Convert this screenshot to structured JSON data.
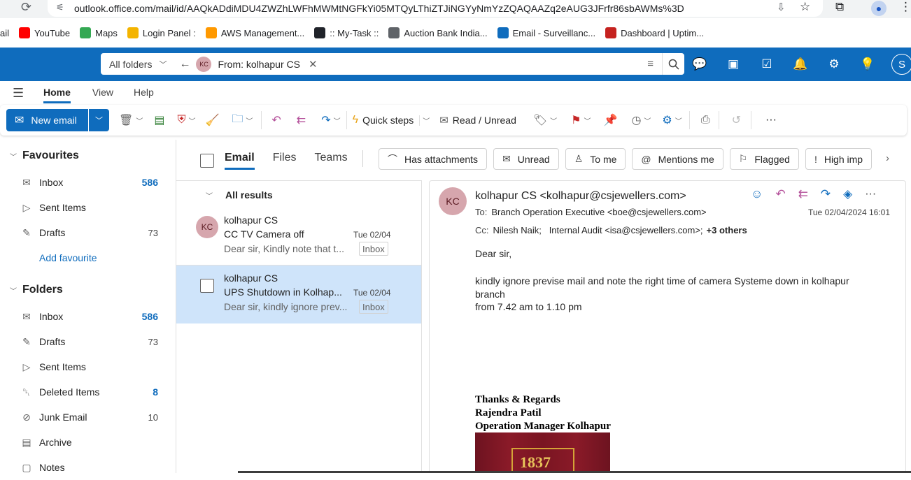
{
  "browser": {
    "url": "outlook.office.com/mail/id/AAQkADdiMDU4ZWZhLWFhMWMtNGFkYi05MTQyLThiZTJiNGYyNmYzZQAQAAZq2eAUG3JFrfr86sbAWMs%3D",
    "bookmarks": [
      {
        "label": "ail",
        "icon": "gmail-icon",
        "color": "#ea4335"
      },
      {
        "label": "YouTube",
        "icon": "youtube-icon",
        "color": "#ff0000"
      },
      {
        "label": "Maps",
        "icon": "maps-icon",
        "color": "#34a853"
      },
      {
        "label": "Login Panel :",
        "icon": "login-icon",
        "color": "#f4b400"
      },
      {
        "label": "AWS Management...",
        "icon": "aws-icon",
        "color": "#ff9900"
      },
      {
        "label": ":: My-Task ::",
        "icon": "react-icon",
        "color": "#20232a"
      },
      {
        "label": "Auction Bank India...",
        "icon": "bank-icon",
        "color": "#5f6368"
      },
      {
        "label": "Email - Surveillanc...",
        "icon": "outlook-icon",
        "color": "#0f6cbd"
      },
      {
        "label": "Dashboard | Uptim...",
        "icon": "uptime-icon",
        "color": "#c5221f"
      }
    ]
  },
  "header": {
    "scope": "All folders",
    "chip_initials": "KC",
    "chip_label": "From: kolhapur CS",
    "profile_initial": "S"
  },
  "ribbon": {
    "tabs": [
      "Home",
      "View",
      "Help"
    ],
    "new_email": "New email",
    "quick_steps": "Quick steps",
    "read_unread": "Read / Unread",
    "more": "···"
  },
  "folders": {
    "favourites_title": "Favourites",
    "favourites": [
      {
        "icon": "inbox-icon",
        "glyph": "✉",
        "label": "Inbox",
        "count": "586",
        "bold": true
      },
      {
        "icon": "send-icon",
        "glyph": "▷",
        "label": "Sent Items",
        "count": "",
        "bold": false
      },
      {
        "icon": "pencil-icon",
        "glyph": "✎",
        "label": "Drafts",
        "count": "73",
        "bold": false
      }
    ],
    "add_favourite": "Add favourite",
    "folders_title": "Folders",
    "items": [
      {
        "icon": "inbox-icon",
        "glyph": "✉",
        "label": "Inbox",
        "count": "586",
        "bold": true
      },
      {
        "icon": "pencil-icon",
        "glyph": "✎",
        "label": "Drafts",
        "count": "73",
        "bold": false
      },
      {
        "icon": "send-icon",
        "glyph": "▷",
        "label": "Sent Items",
        "count": "",
        "bold": false
      },
      {
        "icon": "trash-icon",
        "glyph": "␡",
        "label": "Deleted Items",
        "count": "8",
        "bold": true
      },
      {
        "icon": "junk-icon",
        "glyph": "⊘",
        "label": "Junk Email",
        "count": "10",
        "bold": false
      },
      {
        "icon": "archive-icon",
        "glyph": "▤",
        "label": "Archive",
        "count": "",
        "bold": false
      },
      {
        "icon": "notes-icon",
        "glyph": "▢",
        "label": "Notes",
        "count": "",
        "bold": false
      }
    ]
  },
  "filters": {
    "tabs": [
      "Email",
      "Files",
      "Teams"
    ],
    "pills": [
      {
        "icon": "paperclip-icon",
        "glyph": "⌒",
        "label": "Has attachments"
      },
      {
        "icon": "unread-icon",
        "glyph": "✉",
        "label": "Unread"
      },
      {
        "icon": "person-icon",
        "glyph": "♙",
        "label": "To me"
      },
      {
        "icon": "mention-icon",
        "glyph": "@",
        "label": "Mentions me"
      },
      {
        "icon": "flag-icon",
        "glyph": "⚐",
        "label": "Flagged"
      },
      {
        "icon": "importance-icon",
        "glyph": "!",
        "label": "High imp"
      }
    ]
  },
  "list": {
    "group": "All results",
    "messages": [
      {
        "initials": "KC",
        "sender": "kolhapur CS",
        "subject": "CC TV Camera off",
        "date": "Tue 02/04",
        "preview": "Dear sir, Kindly note that t...",
        "folder": "Inbox",
        "selected": false
      },
      {
        "initials": "",
        "sender": "kolhapur CS",
        "subject": "UPS Shutdown in Kolhap...",
        "date": "Tue 02/04",
        "preview": "Dear sir, kindly ignore prev...",
        "folder": "Inbox",
        "selected": true
      }
    ]
  },
  "reading": {
    "initials": "KC",
    "from": "kolhapur CS <kolhapur@csjewellers.com>",
    "to_label": "To:",
    "to": "Branch Operation Executive <boe@csjewellers.com>",
    "datetime": "Tue 02/04/2024 16:01",
    "cc_label": "Cc:",
    "cc": "Nilesh Naik;   Internal Audit <isa@csjewellers.com>;",
    "cc_more": "+3 others",
    "greeting": "Dear sir,",
    "body1": "kindly ignore previse mail and note the right time of camera Systeme down in kolhapur branch",
    "body2": "from 7.42 am to 1.10 pm",
    "sig1": "Thanks & Regards",
    "sig2": "Rajendra Patil",
    "sig3": "Operation Manager Kolhapur",
    "banner_text": "1837"
  },
  "colors": {
    "brand": "#0f6cbd",
    "selected_row": "#cfe4fa",
    "avatar_bg": "#d6a6ad"
  }
}
